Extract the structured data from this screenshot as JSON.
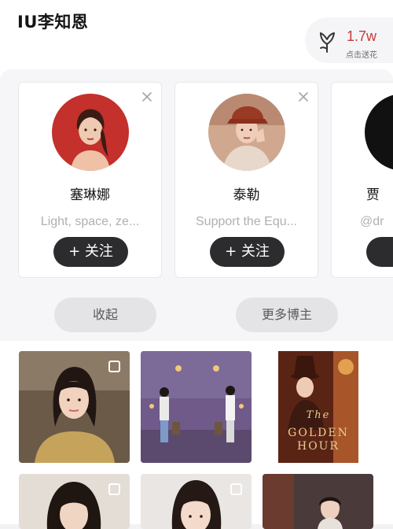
{
  "header": {
    "title": "IU李知恩",
    "flower_count": "1.7w",
    "flower_label": "点击送花"
  },
  "recommendations": [
    {
      "name": "塞琳娜",
      "desc": "Light, space, ze...",
      "follow_label": "+ 关注"
    },
    {
      "name": "泰勒",
      "desc": "Support the Equ...",
      "follow_label": "+ 关注"
    },
    {
      "name": "贾",
      "desc": "@dr",
      "follow_label": "+"
    }
  ],
  "actions": {
    "collapse_label": "收起",
    "more_label": "更多博主"
  },
  "poster": {
    "script_word": "The",
    "word1": "GOLDEN",
    "word2": "HOUR"
  },
  "icons": {
    "flower": "flower-icon",
    "close": "close-icon",
    "select": "select-checkbox-icon"
  },
  "colors": {
    "accent_red": "#c53a3a",
    "follow_button": "#2c2c2e"
  }
}
